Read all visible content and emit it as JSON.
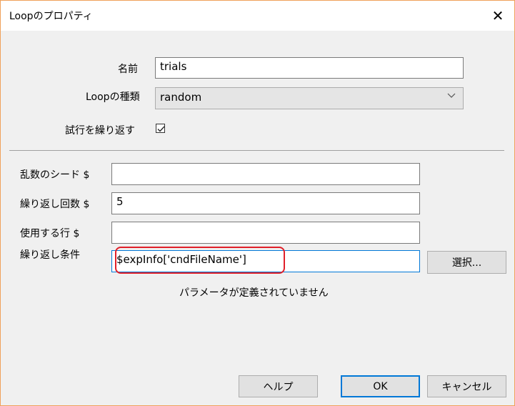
{
  "window": {
    "title": "Loopのプロパティ",
    "close_glyph": "✕"
  },
  "fields": {
    "name_label": "名前",
    "name_value": "trials",
    "loop_type_label": "Loopの種類",
    "loop_type_value": "random",
    "repeat_label": "試行を繰り返す",
    "repeat_checked": true,
    "random_seed_label": "乱数のシード $",
    "random_seed_value": "",
    "n_reps_label": "繰り返し回数 $",
    "n_reps_value": "5",
    "selected_rows_label": "使用する行 $",
    "selected_rows_value": "",
    "conditions_label": "繰り返し条件",
    "conditions_value": "$expInfo['cndFileName']",
    "browse_label": "選択..."
  },
  "status": {
    "message": "パラメータが定義されていません"
  },
  "buttons": {
    "help_label": "ヘルプ",
    "ok_label": "OK",
    "cancel_label": "キャンセル"
  },
  "colors": {
    "accent": "#0078d7",
    "highlight": "#e0202a",
    "window_border": "#f0a15a"
  },
  "icons": {
    "close": "close-icon",
    "chevron": "chevron-down-icon",
    "check": "checkmark-icon"
  }
}
